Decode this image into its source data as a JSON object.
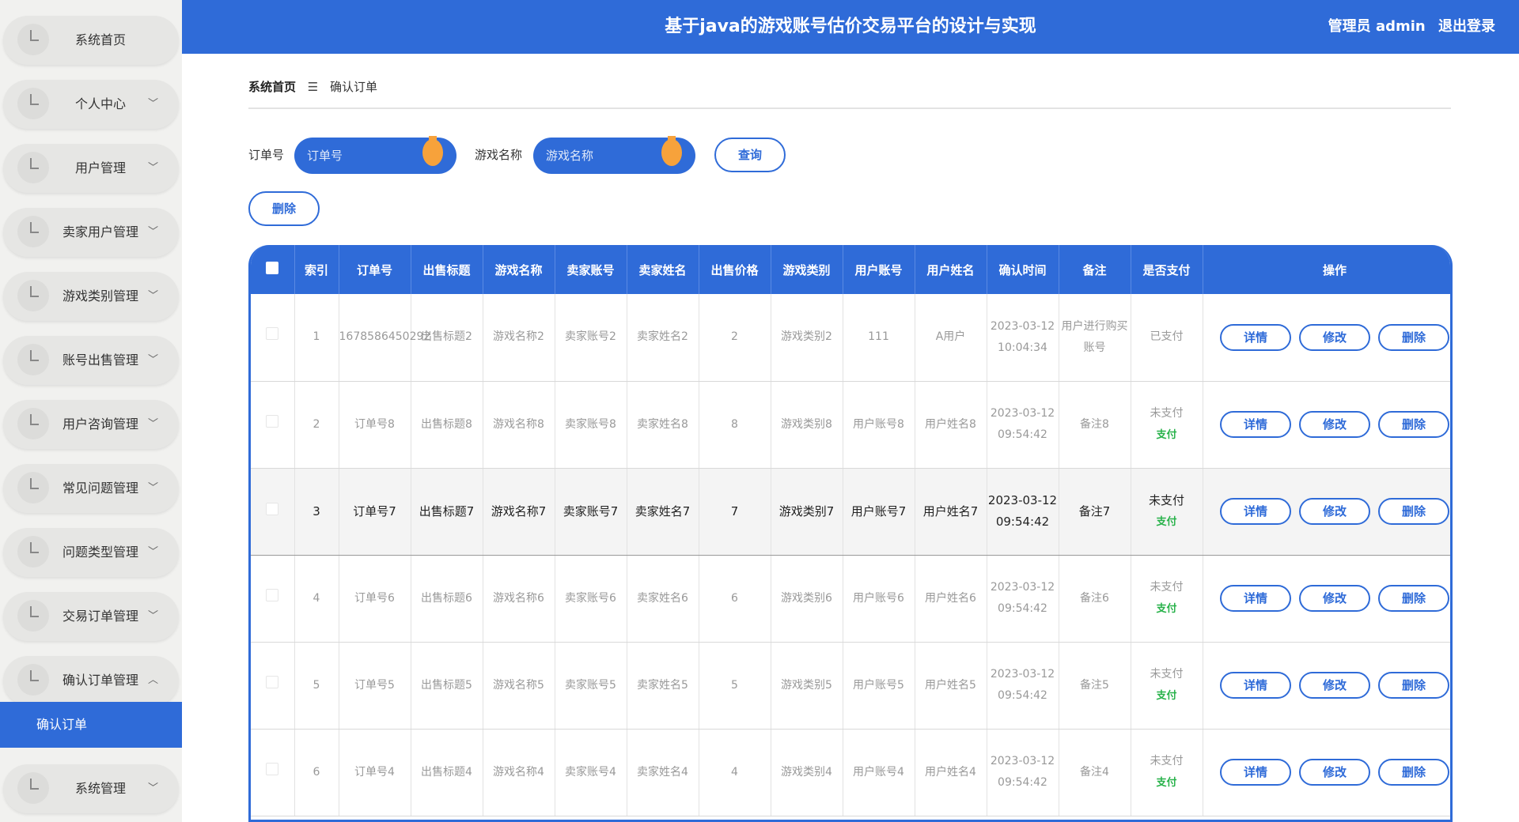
{
  "header": {
    "title": "基于java的游戏账号估价交易平台的设计与实现",
    "user_label": "管理员 admin",
    "logout": "退出登录"
  },
  "sidebar": {
    "items": [
      {
        "label": "系统首页",
        "chevron": ""
      },
      {
        "label": "个人中心",
        "chevron": "﹀"
      },
      {
        "label": "用户管理",
        "chevron": "﹀"
      },
      {
        "label": "卖家用户管理",
        "chevron": "﹀"
      },
      {
        "label": "游戏类别管理",
        "chevron": "﹀"
      },
      {
        "label": "账号出售管理",
        "chevron": "﹀"
      },
      {
        "label": "用户咨询管理",
        "chevron": "﹀"
      },
      {
        "label": "常见问题管理",
        "chevron": "﹀"
      },
      {
        "label": "问题类型管理",
        "chevron": "﹀"
      },
      {
        "label": "交易订单管理",
        "chevron": "﹀"
      },
      {
        "label": "确认订单管理",
        "chevron": "︿"
      },
      {
        "label": "系统管理",
        "chevron": "﹀"
      }
    ],
    "active_sub": "确认订单"
  },
  "breadcrumb": {
    "home": "系统首页",
    "sep": "☰",
    "current": "确认订单"
  },
  "search": {
    "order_label": "订单号",
    "order_placeholder": "订单号",
    "game_label": "游戏名称",
    "game_placeholder": "游戏名称",
    "query_button": "查询",
    "delete_button": "删除"
  },
  "table": {
    "columns": [
      "索引",
      "订单号",
      "出售标题",
      "游戏名称",
      "卖家账号",
      "卖家姓名",
      "出售价格",
      "游戏类别",
      "用户账号",
      "用户姓名",
      "确认时间",
      "备注",
      "是否支付",
      "操作"
    ],
    "actions": {
      "detail": "详情",
      "edit": "修改",
      "delete": "删除"
    },
    "pay_link": "支付",
    "rows": [
      {
        "index": "1",
        "order": "1678586450292",
        "title": "出售标题2",
        "game": "游戏名称2",
        "seller_acc": "卖家账号2",
        "seller_name": "卖家姓名2",
        "price": "2",
        "category": "游戏类别2",
        "user_acc": "111",
        "user_name": "A用户",
        "time": "2023-03-12 10:04:34",
        "note": "用户进行购买账号",
        "status": "已支付",
        "show_pay": false
      },
      {
        "index": "2",
        "order": "订单号8",
        "title": "出售标题8",
        "game": "游戏名称8",
        "seller_acc": "卖家账号8",
        "seller_name": "卖家姓名8",
        "price": "8",
        "category": "游戏类别8",
        "user_acc": "用户账号8",
        "user_name": "用户姓名8",
        "time": "2023-03-12 09:54:42",
        "note": "备注8",
        "status": "未支付",
        "show_pay": true
      },
      {
        "index": "3",
        "order": "订单号7",
        "title": "出售标题7",
        "game": "游戏名称7",
        "seller_acc": "卖家账号7",
        "seller_name": "卖家姓名7",
        "price": "7",
        "category": "游戏类别7",
        "user_acc": "用户账号7",
        "user_name": "用户姓名7",
        "time": "2023-03-12 09:54:42",
        "note": "备注7",
        "status": "未支付",
        "show_pay": true
      },
      {
        "index": "4",
        "order": "订单号6",
        "title": "出售标题6",
        "game": "游戏名称6",
        "seller_acc": "卖家账号6",
        "seller_name": "卖家姓名6",
        "price": "6",
        "category": "游戏类别6",
        "user_acc": "用户账号6",
        "user_name": "用户姓名6",
        "time": "2023-03-12 09:54:42",
        "note": "备注6",
        "status": "未支付",
        "show_pay": true
      },
      {
        "index": "5",
        "order": "订单号5",
        "title": "出售标题5",
        "game": "游戏名称5",
        "seller_acc": "卖家账号5",
        "seller_name": "卖家姓名5",
        "price": "5",
        "category": "游戏类别5",
        "user_acc": "用户账号5",
        "user_name": "用户姓名5",
        "time": "2023-03-12 09:54:42",
        "note": "备注5",
        "status": "未支付",
        "show_pay": true
      },
      {
        "index": "6",
        "order": "订单号4",
        "title": "出售标题4",
        "game": "游戏名称4",
        "seller_acc": "卖家账号4",
        "seller_name": "卖家姓名4",
        "price": "4",
        "category": "游戏类别4",
        "user_acc": "用户账号4",
        "user_name": "用户姓名4",
        "time": "2023-03-12 09:54:42",
        "note": "备注4",
        "status": "未支付",
        "show_pay": true
      }
    ]
  },
  "colors": {
    "primary": "#2f6bd8",
    "accent": "#f7a23b",
    "paid": "#28b24a"
  }
}
